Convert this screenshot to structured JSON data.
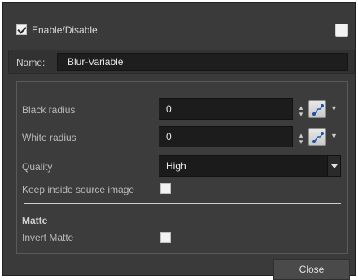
{
  "header": {
    "enable_label": "Enable/Disable",
    "enable_checked": true
  },
  "name": {
    "label": "Name:",
    "value": "Blur-Variable"
  },
  "props": {
    "black_radius_label": "Black radius",
    "black_radius_value": "0",
    "white_radius_label": "White radius",
    "white_radius_value": "0",
    "quality_label": "Quality",
    "quality_value": "High",
    "keep_inside_label": "Keep inside source image",
    "matte_title": "Matte",
    "invert_matte_label": "Invert Matte"
  },
  "icons": {
    "function_button": "function-curve-icon",
    "spin_arrows": "spin-arrows-icon",
    "dropdown_arrow": "chevron-down-icon"
  },
  "footer": {
    "close_label": "Close"
  }
}
